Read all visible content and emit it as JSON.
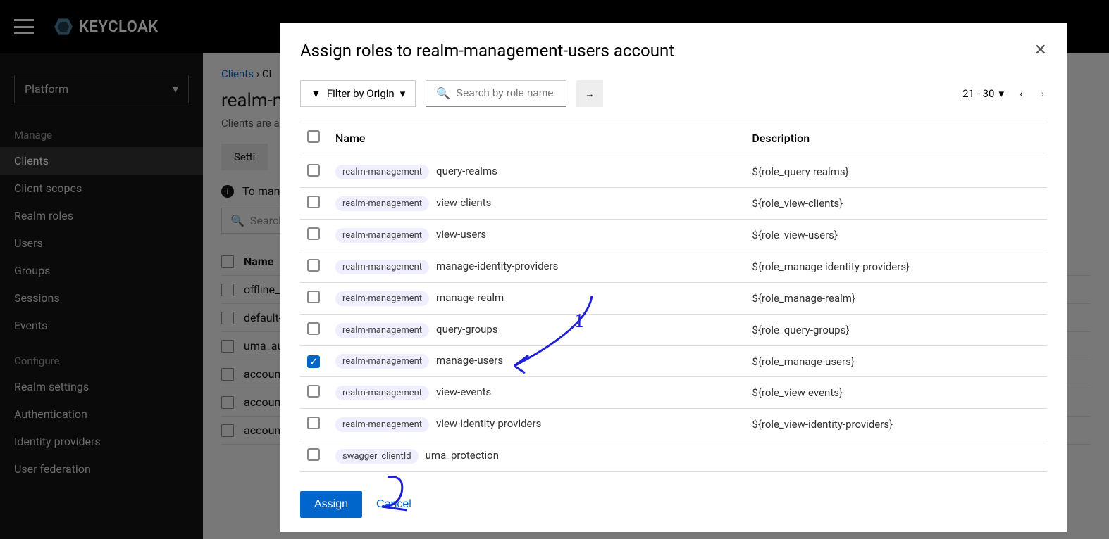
{
  "brand": "KEYCLOAK",
  "realm_selector": "Platform",
  "sidebar": {
    "manage_label": "Manage",
    "configure_label": "Configure",
    "items": {
      "clients": "Clients",
      "client_scopes": "Client scopes",
      "realm_roles": "Realm roles",
      "users": "Users",
      "groups": "Groups",
      "sessions": "Sessions",
      "events": "Events",
      "realm_settings": "Realm settings",
      "authentication": "Authentication",
      "identity_providers": "Identity providers",
      "user_federation": "User federation"
    }
  },
  "breadcrumb": {
    "clients": "Clients",
    "detail_prefix": "Cl"
  },
  "page": {
    "title_visible": "realm-m",
    "desc_visible": "Clients are a",
    "tab_settings": "Setti",
    "info_text": "To manage",
    "search_visible": "Search b",
    "col_name": "Name"
  },
  "bg_rows": [
    "offline_a",
    "default-",
    "uma_au",
    "accoun",
    "accoun",
    "accoun"
  ],
  "modal": {
    "title": "Assign roles to realm-management-users account",
    "filter_label": "Filter by Origin",
    "search_placeholder": "Search by role name",
    "range_label": "21 - 30",
    "col_name": "Name",
    "col_description": "Description",
    "assign_label": "Assign",
    "cancel_label": "Cancel"
  },
  "roles": [
    {
      "origin": "realm-management",
      "name": "query-realms",
      "desc": "${role_query-realms}",
      "checked": false
    },
    {
      "origin": "realm-management",
      "name": "view-clients",
      "desc": "${role_view-clients}",
      "checked": false
    },
    {
      "origin": "realm-management",
      "name": "view-users",
      "desc": "${role_view-users}",
      "checked": false
    },
    {
      "origin": "realm-management",
      "name": "manage-identity-providers",
      "desc": "${role_manage-identity-providers}",
      "checked": false
    },
    {
      "origin": "realm-management",
      "name": "manage-realm",
      "desc": "${role_manage-realm}",
      "checked": false
    },
    {
      "origin": "realm-management",
      "name": "query-groups",
      "desc": "${role_query-groups}",
      "checked": false
    },
    {
      "origin": "realm-management",
      "name": "manage-users",
      "desc": "${role_manage-users}",
      "checked": true
    },
    {
      "origin": "realm-management",
      "name": "view-events",
      "desc": "${role_view-events}",
      "checked": false
    },
    {
      "origin": "realm-management",
      "name": "view-identity-providers",
      "desc": "${role_view-identity-providers}",
      "checked": false
    },
    {
      "origin": "swagger_clientId",
      "name": "uma_protection",
      "desc": "",
      "checked": false
    }
  ]
}
